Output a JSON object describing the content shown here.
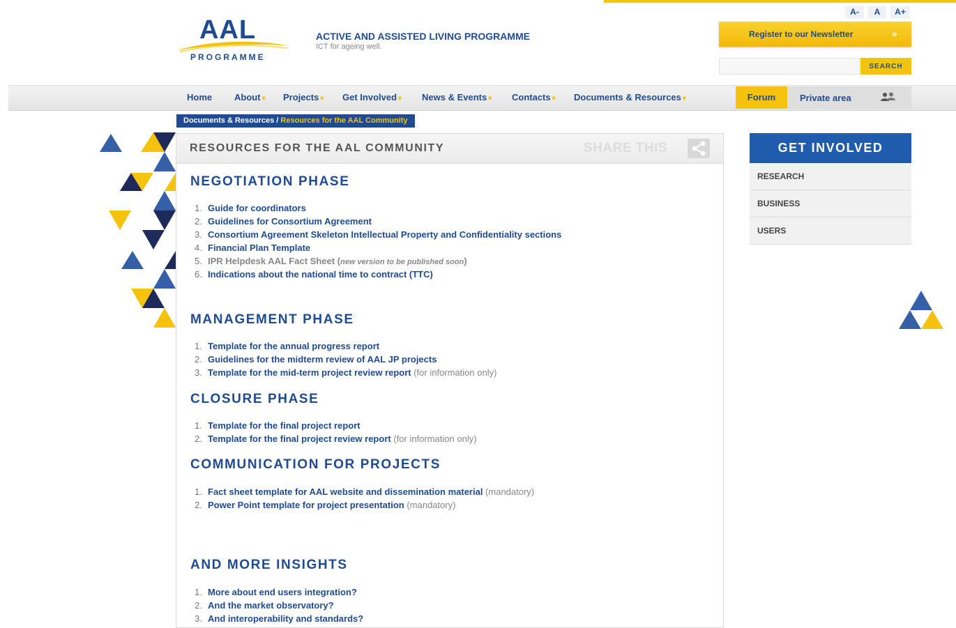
{
  "header": {
    "logo_text": "AAL",
    "logo_subtext": "PROGRAMME",
    "program_title": "ACTIVE AND ASSISTED LIVING PROGRAMME",
    "tagline": "ICT for ageing well.",
    "font_size_buttons": [
      "A-",
      "A",
      "A+"
    ],
    "newsletter_label": "Register to our Newsletter",
    "newsletter_arrow": "»",
    "search_placeholder": "",
    "search_button": "SEARCH"
  },
  "nav": {
    "items": [
      {
        "label": "Home",
        "dropdown": false
      },
      {
        "label": "About",
        "dropdown": true
      },
      {
        "label": "Projects",
        "dropdown": true
      },
      {
        "label": "Get Involved",
        "dropdown": true
      },
      {
        "label": "News & Events",
        "dropdown": true
      },
      {
        "label": "Contacts",
        "dropdown": true
      },
      {
        "label": "Documents & Resources",
        "dropdown": true
      }
    ],
    "forum": "Forum",
    "private_area": "Private area",
    "caret": "▾"
  },
  "breadcrumb": {
    "parent": "Documents & Resources",
    "separator": " / ",
    "current": "Resources for the AAL Community"
  },
  "content": {
    "title": "RESOURCES FOR THE AAL COMMUNITY",
    "share_label": "SHARE THIS",
    "sections": [
      {
        "heading": "NEGOTIATION PHASE",
        "items": [
          {
            "num": "1.",
            "link": "Guide for coordinators",
            "note": ""
          },
          {
            "num": "2.",
            "link": "Guidelines for Consortium Agreement",
            "note": ""
          },
          {
            "num": "3.",
            "link": "Consortium Agreement Skeleton Intellectual Property and Confidentiality sections",
            "note": ""
          },
          {
            "num": "4.",
            "link": "Financial Plan Template",
            "note": ""
          },
          {
            "num": "5.",
            "link": "",
            "gray": "IPR Helpdesk AAL Fact Sheet (",
            "gray_em": "new version to be published soon",
            "gray_end": ")"
          },
          {
            "num": "6.",
            "link": "Indications about the national time to contract (TTC)",
            "note": ""
          }
        ]
      },
      {
        "heading": "MANAGEMENT PHASE",
        "items": [
          {
            "num": "1.",
            "link": "Template for the annual progress report",
            "note": ""
          },
          {
            "num": "2.",
            "link": "Guidelines for the midterm review of AAL JP projects",
            "note": ""
          },
          {
            "num": "3.",
            "link": "Template for the mid-term project review report",
            "note": " (for information only)"
          }
        ]
      },
      {
        "heading": "CLOSURE PHASE",
        "items": [
          {
            "num": "1.",
            "link": "Template for the final project report",
            "note": ""
          },
          {
            "num": "2.",
            "link": "Template for the final project review report",
            "note": " (for information only)"
          }
        ]
      },
      {
        "heading": "COMMUNICATION FOR PROJECTS",
        "items": [
          {
            "num": "1.",
            "link": "Fact sheet template for AAL website and dissemination material",
            "note": " (mandatory)"
          },
          {
            "num": "2.",
            "link": "Power Point template for project presentation",
            "note": " (mandatory)"
          }
        ]
      },
      {
        "heading": "AND MORE INSIGHTS",
        "items": [
          {
            "num": "1.",
            "link": "More about end users integration?",
            "note": ""
          },
          {
            "num": "2.",
            "link": "And the market observatory?",
            "note": ""
          },
          {
            "num": "3.",
            "link": "And interoperability and standards?",
            "note": ""
          }
        ]
      }
    ]
  },
  "sidebar": {
    "title": "GET INVOLVED",
    "items": [
      "RESEARCH",
      "BUSINESS",
      "USERS"
    ]
  },
  "colors": {
    "brand_blue": "#1f4b93",
    "brand_yellow": "#f5c20e",
    "sidebar_blue": "#1f5cad"
  }
}
